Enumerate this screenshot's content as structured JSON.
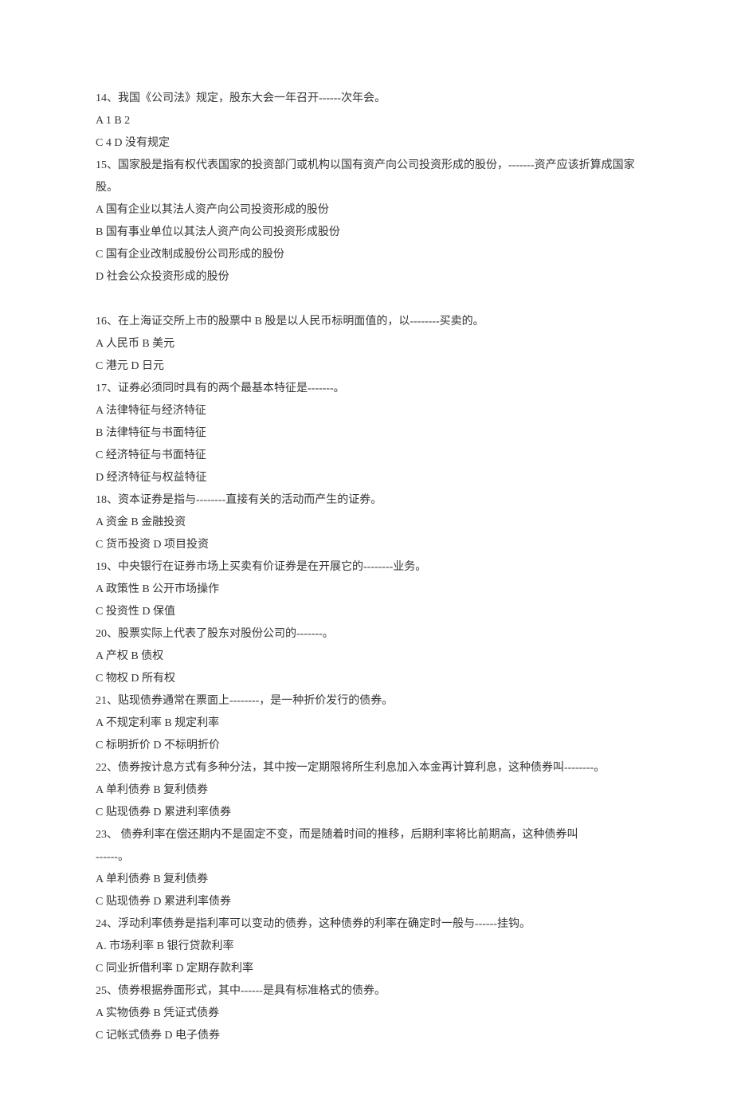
{
  "questions": [
    {
      "num": "14",
      "text": "14、我国《公司法》规定，股东大会一年召开------次年会。",
      "options": [
        "A  1  B  2",
        "C  4  D  没有规定"
      ]
    },
    {
      "num": "15",
      "text": "15、国家股是指有权代表国家的投资部门或机构以国有资产向公司投资形成的股份，-------资产应该折算成国家股。",
      "options": [
        "A 国有企业以其法人资产向公司投资形成的股份",
        "B  国有事业单位以其法人资产向公司投资形成股份",
        "C  国有企业改制成股份公司形成的股份",
        "D  社会公众投资形成的股份"
      ],
      "spacer_after": true
    },
    {
      "num": "16",
      "text": "16、在上海证交所上市的股票中 B 股是以人民币标明面值的，以--------买卖的。",
      "options": [
        "A  人民币  B  美元",
        "C  港元  D  日元"
      ]
    },
    {
      "num": "17",
      "text": "17、证券必须同时具有的两个最基本特征是-------。",
      "options": [
        "A  法律特征与经济特征",
        "B  法律特征与书面特征",
        "C  经济特征与书面特征",
        "D  经济特征与权益特征"
      ]
    },
    {
      "num": "18",
      "text": "18、资本证券是指与--------直接有关的活动而产生的证券。",
      "options": [
        "A  资金  B  金融投资",
        "C  货币投资  D  项目投资"
      ]
    },
    {
      "num": "19",
      "text": "19、中央银行在证券市场上买卖有价证券是在开展它的--------业务。",
      "options": [
        "A  政策性  B  公开市场操作",
        "C  投资性  D  保值"
      ]
    },
    {
      "num": "20",
      "text": "20、股票实际上代表了股东对股份公司的-------。",
      "options": [
        "A  产权  B  债权",
        "C  物权  D  所有权"
      ]
    },
    {
      "num": "21",
      "text": "21、贴现债券通常在票面上--------，是一种折价发行的债券。",
      "options": [
        "A  不规定利率  B  规定利率",
        "C  标明折价  D  不标明折价"
      ]
    },
    {
      "num": "22",
      "text": "22、债券按计息方式有多种分法，其中按一定期限将所生利息加入本金再计算利息，这种债券叫--------。",
      "options": [
        "",
        "A  单利债券  B  复利债券",
        "C  贴现债券  D  累进利率债券"
      ]
    },
    {
      "num": "23",
      "text": "23、  债券利率在偿还期内不是固定不变，而是随着时间的推移，后期利率将比前期高，这种债券叫",
      "options": [
        "------。",
        "A  单利债券  B  复利债券",
        "C  贴现债券  D  累进利率债券"
      ]
    },
    {
      "num": "24",
      "text": "24、浮动利率债券是指利率可以变动的债券，这种债券的利率在确定时一般与------挂钩。",
      "options": [
        "A.  市场利率  B  银行贷款利率",
        "C  同业折借利率  D  定期存款利率"
      ]
    },
    {
      "num": "25",
      "text": "25、债券根据券面形式，其中------是具有标准格式的债券。",
      "options": [
        "A  实物债券  B  凭证式债券",
        "C  记帐式债券  D  电子债券"
      ]
    }
  ]
}
